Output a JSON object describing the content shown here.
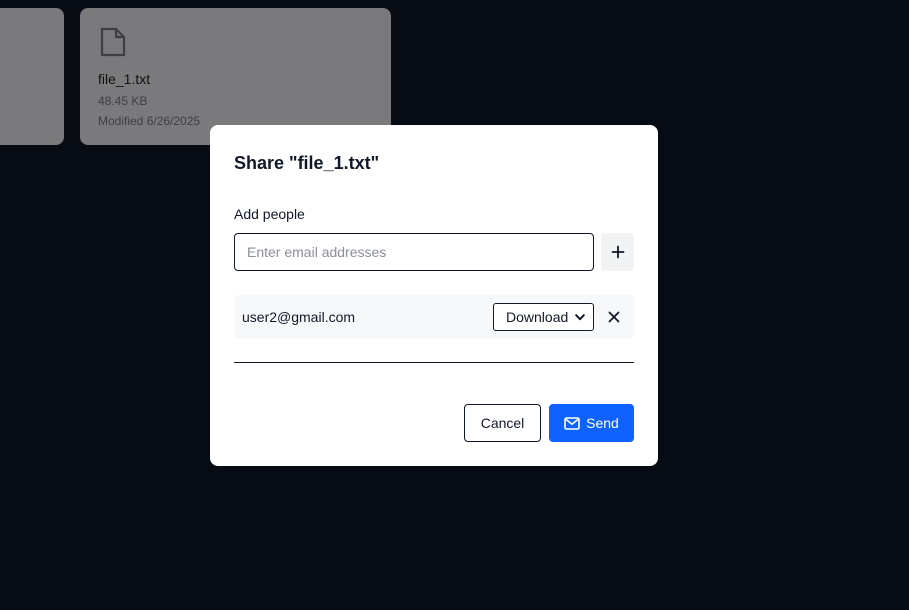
{
  "background": {
    "file_card": {
      "name": "file_1.txt",
      "size": "48.45 KB",
      "modified": "Modified 6/26/2025",
      "icon": "file-icon"
    }
  },
  "modal": {
    "title": "Share \"file_1.txt\"",
    "add_people_label": "Add people",
    "email_input": {
      "value": "",
      "placeholder": "Enter email addresses"
    },
    "add_button_icon": "plus-icon",
    "shared_with": [
      {
        "email": "user2@gmail.com",
        "permission": "Download",
        "remove_icon": "close-icon"
      }
    ],
    "cancel_label": "Cancel",
    "send_label": "Send",
    "send_icon": "mail-icon"
  },
  "colors": {
    "page_background": "#070b14",
    "card_background_dimmed": "#7a7a7c",
    "primary_accent": "#0f62fe",
    "row_background": "#f7f8fa"
  }
}
